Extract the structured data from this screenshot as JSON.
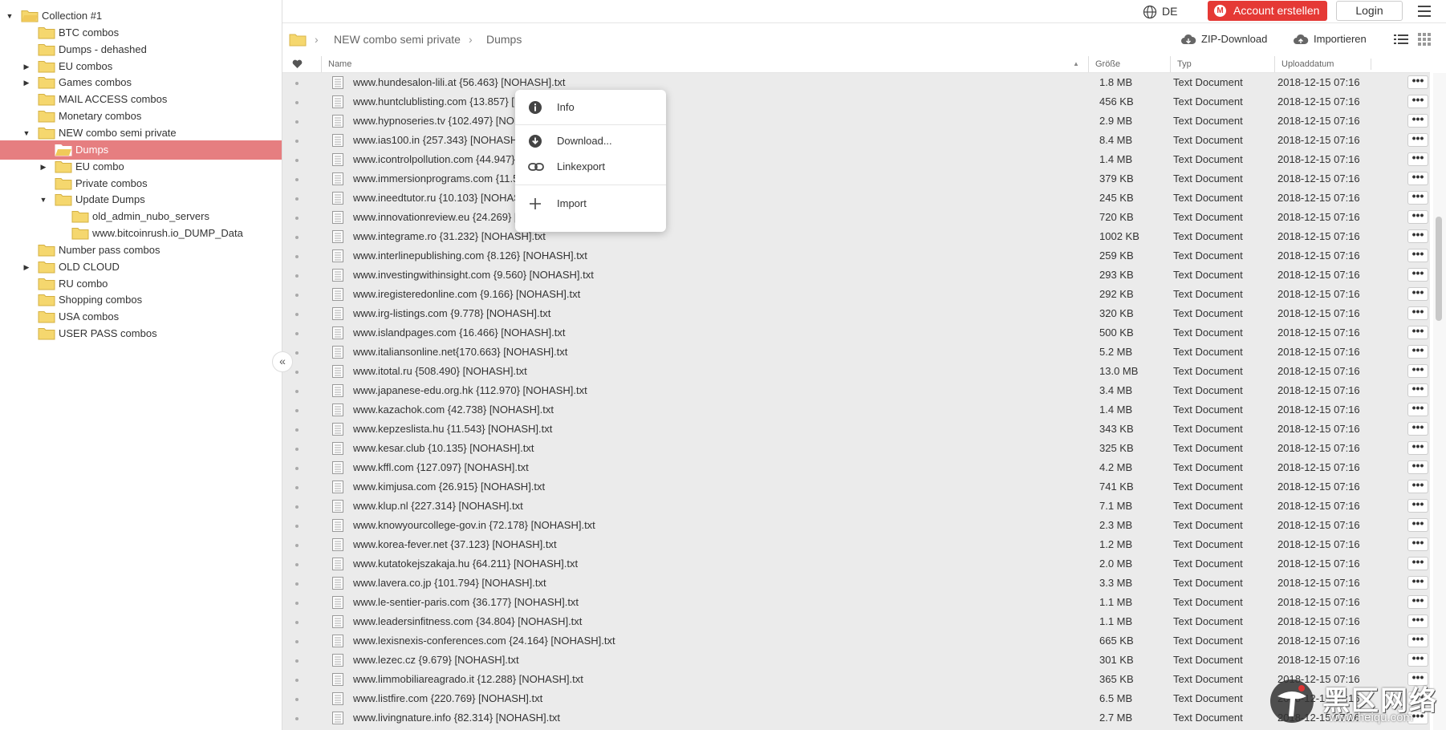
{
  "sidebar": {
    "items": [
      {
        "label": "Collection #1",
        "depth": 0,
        "arrow": "down"
      },
      {
        "label": "BTC combos",
        "depth": 1,
        "arrow": ""
      },
      {
        "label": "Dumps - dehashed",
        "depth": 1,
        "arrow": ""
      },
      {
        "label": "EU combos",
        "depth": 1,
        "arrow": "right"
      },
      {
        "label": "Games combos",
        "depth": 1,
        "arrow": "right"
      },
      {
        "label": "MAIL ACCESS combos",
        "depth": 1,
        "arrow": ""
      },
      {
        "label": "Monetary combos",
        "depth": 1,
        "arrow": ""
      },
      {
        "label": "NEW combo semi private",
        "depth": 1,
        "arrow": "down"
      },
      {
        "label": "Dumps",
        "depth": 2,
        "arrow": "",
        "selected": true
      },
      {
        "label": "EU combo",
        "depth": 2,
        "arrow": "right"
      },
      {
        "label": "Private combos",
        "depth": 2,
        "arrow": ""
      },
      {
        "label": "Update Dumps",
        "depth": 2,
        "arrow": "down"
      },
      {
        "label": "old_admin_nubo_servers",
        "depth": 3,
        "arrow": ""
      },
      {
        "label": "www.bitcoinrush.io_DUMP_Data",
        "depth": 3,
        "arrow": ""
      },
      {
        "label": "Number pass combos",
        "depth": 1,
        "arrow": ""
      },
      {
        "label": "OLD CLOUD",
        "depth": 1,
        "arrow": "right"
      },
      {
        "label": "RU combo",
        "depth": 1,
        "arrow": ""
      },
      {
        "label": "Shopping combos",
        "depth": 1,
        "arrow": ""
      },
      {
        "label": "USA combos",
        "depth": 1,
        "arrow": ""
      },
      {
        "label": "USER PASS combos",
        "depth": 1,
        "arrow": ""
      }
    ],
    "collapse_glyph": "«"
  },
  "topbar": {
    "language": "DE",
    "account_button": "Account erstellen",
    "account_logo": "M",
    "login_button": "Login"
  },
  "breadcrumb": {
    "items": [
      "NEW combo semi private",
      "Dumps"
    ]
  },
  "toolbar": {
    "zip_download": "ZIP-Download",
    "import": "Importieren"
  },
  "table": {
    "columns": {
      "name": "Name",
      "size": "Größe",
      "type": "Typ",
      "date": "Uploaddatum"
    },
    "rows": [
      {
        "name": "www.hundesalon-lili.at {56.463} [NOHASH].txt",
        "size": "1.8 MB",
        "type": "Text Document",
        "date": "2018-12-15 07:16"
      },
      {
        "name": "www.huntclublisting.com {13.857} [NOHASH].txt",
        "size": "456 KB",
        "type": "Text Document",
        "date": "2018-12-15 07:16"
      },
      {
        "name": "www.hypnoseries.tv {102.497} [NOHASH].txt",
        "size": "2.9 MB",
        "type": "Text Document",
        "date": "2018-12-15 07:16"
      },
      {
        "name": "www.ias100.in {257.343} [NOHASH].txt",
        "size": "8.4 MB",
        "type": "Text Document",
        "date": "2018-12-15 07:16"
      },
      {
        "name": "www.icontrolpollution.com {44.947} [NOHASH].txt",
        "size": "1.4 MB",
        "type": "Text Document",
        "date": "2018-12-15 07:16"
      },
      {
        "name": "www.immersionprograms.com {11.518} [NOHASH].txt",
        "size": "379 KB",
        "type": "Text Document",
        "date": "2018-12-15 07:16"
      },
      {
        "name": "www.ineedtutor.ru {10.103} [NOHASH].txt",
        "size": "245 KB",
        "type": "Text Document",
        "date": "2018-12-15 07:16"
      },
      {
        "name": "www.innovationreview.eu {24.269} [NOHASH].txt",
        "size": "720 KB",
        "type": "Text Document",
        "date": "2018-12-15 07:16"
      },
      {
        "name": "www.integrame.ro {31.232} [NOHASH].txt",
        "size": "1002 KB",
        "type": "Text Document",
        "date": "2018-12-15 07:16"
      },
      {
        "name": "www.interlinepublishing.com {8.126} [NOHASH].txt",
        "size": "259 KB",
        "type": "Text Document",
        "date": "2018-12-15 07:16"
      },
      {
        "name": "www.investingwithinsight.com {9.560} [NOHASH].txt",
        "size": "293 KB",
        "type": "Text Document",
        "date": "2018-12-15 07:16"
      },
      {
        "name": "www.iregisteredonline.com {9.166} [NOHASH].txt",
        "size": "292 KB",
        "type": "Text Document",
        "date": "2018-12-15 07:16"
      },
      {
        "name": "www.irg-listings.com {9.778} [NOHASH].txt",
        "size": "320 KB",
        "type": "Text Document",
        "date": "2018-12-15 07:16"
      },
      {
        "name": "www.islandpages.com {16.466} [NOHASH].txt",
        "size": "500 KB",
        "type": "Text Document",
        "date": "2018-12-15 07:16"
      },
      {
        "name": "www.italiansonline.net{170.663} [NOHASH].txt",
        "size": "5.2 MB",
        "type": "Text Document",
        "date": "2018-12-15 07:16"
      },
      {
        "name": "www.itotal.ru {508.490} [NOHASH].txt",
        "size": "13.0 MB",
        "type": "Text Document",
        "date": "2018-12-15 07:16"
      },
      {
        "name": "www.japanese-edu.org.hk {112.970} [NOHASH].txt",
        "size": "3.4 MB",
        "type": "Text Document",
        "date": "2018-12-15 07:16"
      },
      {
        "name": "www.kazachok.com {42.738} [NOHASH].txt",
        "size": "1.4 MB",
        "type": "Text Document",
        "date": "2018-12-15 07:16"
      },
      {
        "name": "www.kepzeslista.hu {11.543} [NOHASH].txt",
        "size": "343 KB",
        "type": "Text Document",
        "date": "2018-12-15 07:16"
      },
      {
        "name": "www.kesar.club {10.135} [NOHASH].txt",
        "size": "325 KB",
        "type": "Text Document",
        "date": "2018-12-15 07:16"
      },
      {
        "name": "www.kffl.com {127.097} [NOHASH].txt",
        "size": "4.2 MB",
        "type": "Text Document",
        "date": "2018-12-15 07:16"
      },
      {
        "name": "www.kimjusa.com {26.915} [NOHASH].txt",
        "size": "741 KB",
        "type": "Text Document",
        "date": "2018-12-15 07:16"
      },
      {
        "name": "www.klup.nl {227.314} [NOHASH].txt",
        "size": "7.1 MB",
        "type": "Text Document",
        "date": "2018-12-15 07:16"
      },
      {
        "name": "www.knowyourcollege-gov.in {72.178} [NOHASH].txt",
        "size": "2.3 MB",
        "type": "Text Document",
        "date": "2018-12-15 07:16"
      },
      {
        "name": "www.korea-fever.net {37.123} [NOHASH].txt",
        "size": "1.2 MB",
        "type": "Text Document",
        "date": "2018-12-15 07:16"
      },
      {
        "name": "www.kutatokejszakaja.hu {64.211} [NOHASH].txt",
        "size": "2.0 MB",
        "type": "Text Document",
        "date": "2018-12-15 07:16"
      },
      {
        "name": "www.lavera.co.jp {101.794} [NOHASH].txt",
        "size": "3.3 MB",
        "type": "Text Document",
        "date": "2018-12-15 07:16"
      },
      {
        "name": "www.le-sentier-paris.com {36.177} [NOHASH].txt",
        "size": "1.1 MB",
        "type": "Text Document",
        "date": "2018-12-15 07:16"
      },
      {
        "name": "www.leadersinfitness.com {34.804} [NOHASH].txt",
        "size": "1.1 MB",
        "type": "Text Document",
        "date": "2018-12-15 07:16"
      },
      {
        "name": "www.lexisnexis-conferences.com {24.164} [NOHASH].txt",
        "size": "665 KB",
        "type": "Text Document",
        "date": "2018-12-15 07:16"
      },
      {
        "name": "www.lezec.cz {9.679} [NOHASH].txt",
        "size": "301 KB",
        "type": "Text Document",
        "date": "2018-12-15 07:16"
      },
      {
        "name": "www.limmobiliareagrado.it {12.288} [NOHASH].txt",
        "size": "365 KB",
        "type": "Text Document",
        "date": "2018-12-15 07:16"
      },
      {
        "name": "www.listfire.com {220.769} [NOHASH].txt",
        "size": "6.5 MB",
        "type": "Text Document",
        "date": "2018-12-15 07:16"
      },
      {
        "name": "www.livingnature.info {82.314} [NOHASH].txt",
        "size": "2.7 MB",
        "type": "Text Document",
        "date": "2018-12-15 07:16"
      }
    ],
    "more_glyph": "•••"
  },
  "context_menu": {
    "info": "Info",
    "download": "Download...",
    "linkexport": "Linkexport",
    "import": "Import"
  },
  "watermark": {
    "text": "黑区网络",
    "url": "www.heiqu.com"
  },
  "colors": {
    "accent_red": "#e53935",
    "selected_row": "#e67e80",
    "folder_yellow": "#f5d76e"
  }
}
